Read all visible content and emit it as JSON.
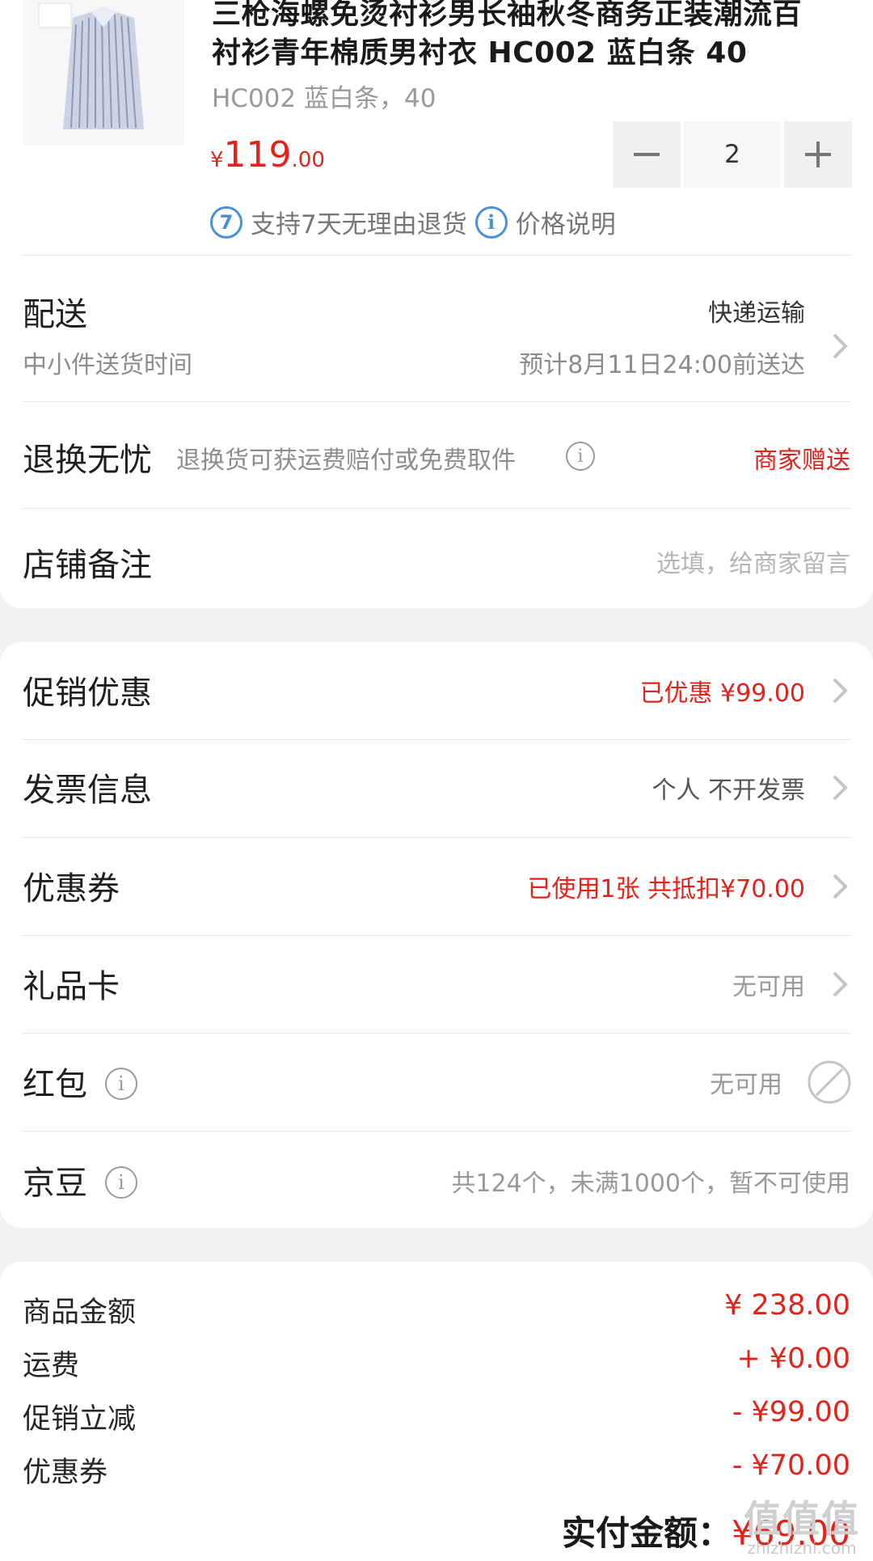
{
  "product": {
    "title_line1": "三枪海螺免烫衬衫男长袖秋冬商务正装潮流百",
    "title_line2": "衬衫青年棉质男衬衣 HC002 蓝白条 40",
    "spec": "HC002 蓝白条，40",
    "price_symbol": "¥",
    "price_int": "119",
    "price_dec": ".00",
    "quantity": "2",
    "return_badge_num": "7",
    "return_text": "支持7天无理由退货",
    "price_note": "价格说明"
  },
  "delivery": {
    "label": "配送",
    "sub": "中小件送货时间",
    "method": "快递运输",
    "estimate": "预计8月11日24:00前送达"
  },
  "return_worry": {
    "label": "退换无忧",
    "desc": "退换货可获运费赔付或免费取件",
    "value": "商家赠送"
  },
  "shop_note": {
    "label": "店铺备注",
    "placeholder": "选填，给商家留言"
  },
  "options": [
    {
      "label": "促销优惠",
      "value": "已优惠 ¥99.00"
    },
    {
      "label": "发票信息",
      "value": "个人 不开发票"
    },
    {
      "label": "优惠券",
      "value": "已使用1张 共抵扣¥70.00"
    },
    {
      "label": "礼品卡",
      "value": "无可用"
    },
    {
      "label": "红包",
      "value": "无可用"
    },
    {
      "label": "京豆",
      "value": "共124个，未满1000个，暂不可使用"
    }
  ],
  "summary": [
    {
      "label": "商品金额",
      "value": "¥ 238.00"
    },
    {
      "label": "运费",
      "value": "+ ¥0.00"
    },
    {
      "label": "促销立减",
      "value": "- ¥99.00"
    },
    {
      "label": "优惠券",
      "value": "- ¥70.00"
    }
  ],
  "total": {
    "label": "实付金额：",
    "value": "¥69.00"
  },
  "watermark": {
    "brand": "值值值",
    "site": "zhizhizhi.com"
  },
  "colors": {
    "accent": "#e2231a",
    "info_blue": "#4a90d9",
    "bg": "#f2f2f2"
  }
}
